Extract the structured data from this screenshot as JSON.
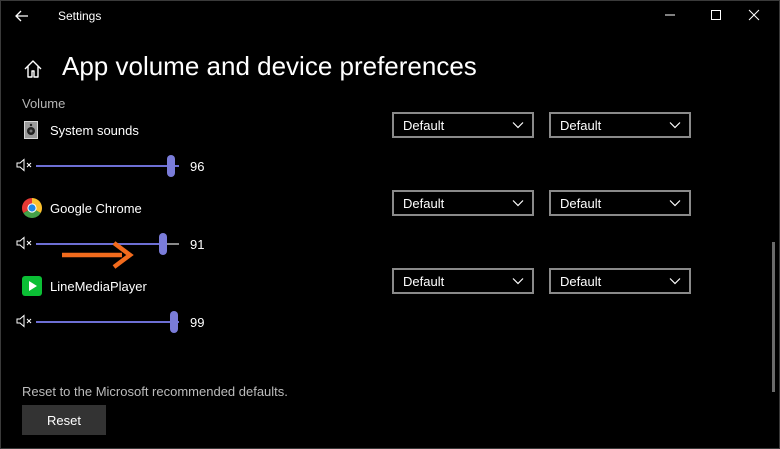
{
  "window": {
    "title": "Settings"
  },
  "page": {
    "title": "App volume and device preferences"
  },
  "section": {
    "label": "Volume"
  },
  "apps": [
    {
      "name": "System sounds",
      "volume_text": "96",
      "volume": 96,
      "output": "Default",
      "input": "Default",
      "icon": "system-sounds-icon"
    },
    {
      "name": "Google Chrome",
      "volume_text": "91",
      "volume": 91,
      "output": "Default",
      "input": "Default",
      "icon": "chrome-icon"
    },
    {
      "name": "LineMediaPlayer",
      "volume_text": "99",
      "volume": 99,
      "output": "Default",
      "input": "Default",
      "icon": "media-player-icon"
    }
  ],
  "reset": {
    "description": "Reset to the Microsoft recommended defaults.",
    "button_label": "Reset"
  },
  "colors": {
    "slider_accent": "#6d6fd4",
    "annotation_arrow": "#f26b1d",
    "background": "#000000"
  }
}
